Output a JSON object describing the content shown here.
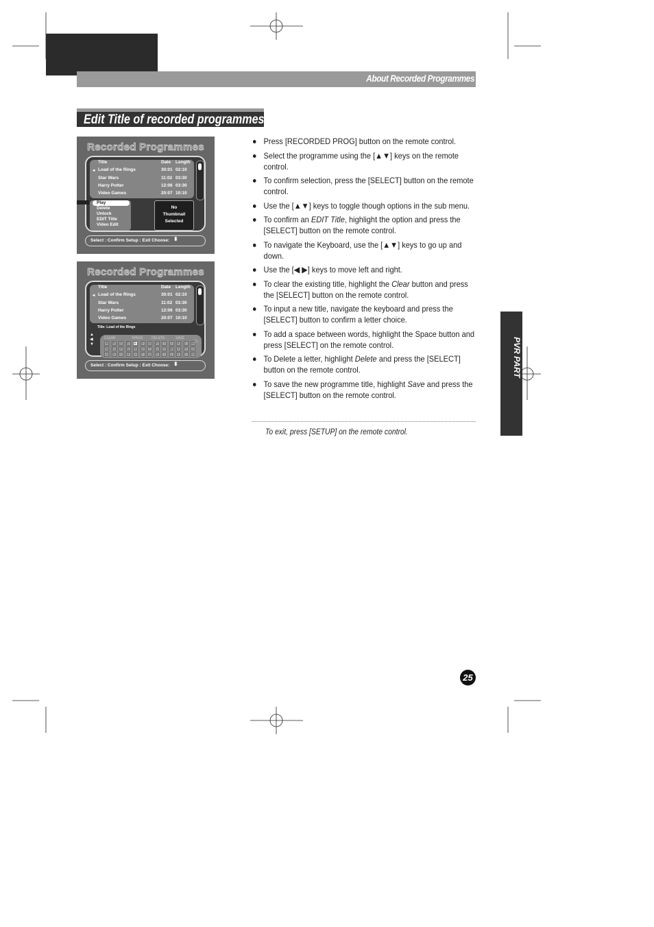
{
  "header": {
    "section_title": "About Recorded Programmes"
  },
  "heading": "Edit Title of recorded programmes",
  "screen1": {
    "title": "Recorded Programmes",
    "columns": {
      "title": "Title",
      "date": "Date",
      "length": "Length"
    },
    "rows": [
      {
        "title": "Load of the Rings",
        "date": "30:01",
        "length": "02:10"
      },
      {
        "title": "Star Wars",
        "date": "11:02",
        "length": "03:30"
      },
      {
        "title": "Harry Potter",
        "date": "12:06",
        "length": "03:30"
      },
      {
        "title": "Video Games",
        "date": "20:07",
        "length": "10:10"
      }
    ],
    "submenu": [
      "Play",
      "Delete",
      "Unlock",
      "EDIT Title",
      "Video Edit"
    ],
    "thumbnail": [
      "No",
      "Thumbnail",
      "Selected"
    ],
    "footer": "Select : Confirm   Setup : Exit   Choose:"
  },
  "screen2": {
    "title": "Recorded Programmes",
    "columns": {
      "title": "Title",
      "date": "Date",
      "length": "Length"
    },
    "rows": [
      {
        "title": "Load of the Rings",
        "date": "30:01",
        "length": "02:10"
      },
      {
        "title": "Star Wars",
        "date": "11:02",
        "length": "03:30"
      },
      {
        "title": "Harry Potter",
        "date": "12:06",
        "length": "03:30"
      },
      {
        "title": "Video Games",
        "date": "20:07",
        "length": "10:10"
      }
    ],
    "title_field": "Title: Load of the Rings",
    "keyboard_actions": [
      "CLEAR",
      "SPACE",
      "DELETE",
      "SAVE"
    ],
    "keyboard_rows": [
      [
        "A",
        "B",
        "C",
        "D",
        "E",
        "F",
        "G",
        "H",
        "I",
        "J",
        "K",
        "L",
        "M"
      ],
      [
        "N",
        "O",
        "P",
        "Q",
        "R",
        "S",
        "T",
        "U",
        "V",
        "W",
        "X",
        "Y",
        "Z"
      ],
      [
        "a",
        "b",
        "c",
        "d",
        "e",
        "f",
        "g",
        "h",
        "i",
        "j",
        "k",
        "l",
        "m"
      ]
    ],
    "highlighted_key": "E",
    "footer": "Select : Confirm   Setup : Exit   Choose:"
  },
  "instructions": [
    {
      "pre": "Press [RECORDED PROG] button on the remote control.",
      "em": "",
      "post": ""
    },
    {
      "pre": "Select the programme using the [▲▼] keys on the remote control.",
      "em": "",
      "post": ""
    },
    {
      "pre": "To confirm selection, press the  [SELECT] button on the remote control.",
      "em": "",
      "post": ""
    },
    {
      "pre": "Use the [▲▼] keys to toggle though options in the sub menu.",
      "em": "",
      "post": ""
    },
    {
      "pre": "To confirm an ",
      "em": "EDIT Title",
      "post": ", highlight the option and press the [SELECT] button on the remote control."
    },
    {
      "pre": "To navigate the Keyboard, use the [▲▼] keys to go up and down.",
      "em": "",
      "post": ""
    },
    {
      "pre": "Use the [◀ ▶] keys to move left and right.",
      "em": "",
      "post": ""
    },
    {
      "pre": "To clear the existing title, highlight the ",
      "em": "Clear",
      "post": " button and press the  [SELECT] button on the remote control."
    },
    {
      "pre": "To input a new title, navigate the keyboard and press the [SELECT] button to confirm a letter choice.",
      "em": "",
      "post": ""
    },
    {
      "pre": "To add a space between words, highlight the Space button and press  [SELECT] on the remote control.",
      "em": "",
      "post": ""
    },
    {
      "pre": "To Delete a letter, highlight ",
      "em": "Delete",
      "post": " and press the  [SELECT] button on the remote control."
    },
    {
      "pre": "To save the new programme title, highlight ",
      "em": "Save",
      "post": " and press the  [SELECT] button on the remote control."
    }
  ],
  "exit_note": "To exit, press [SETUP] on the remote control.",
  "side_tab": "PVR PART",
  "page_number": "25"
}
